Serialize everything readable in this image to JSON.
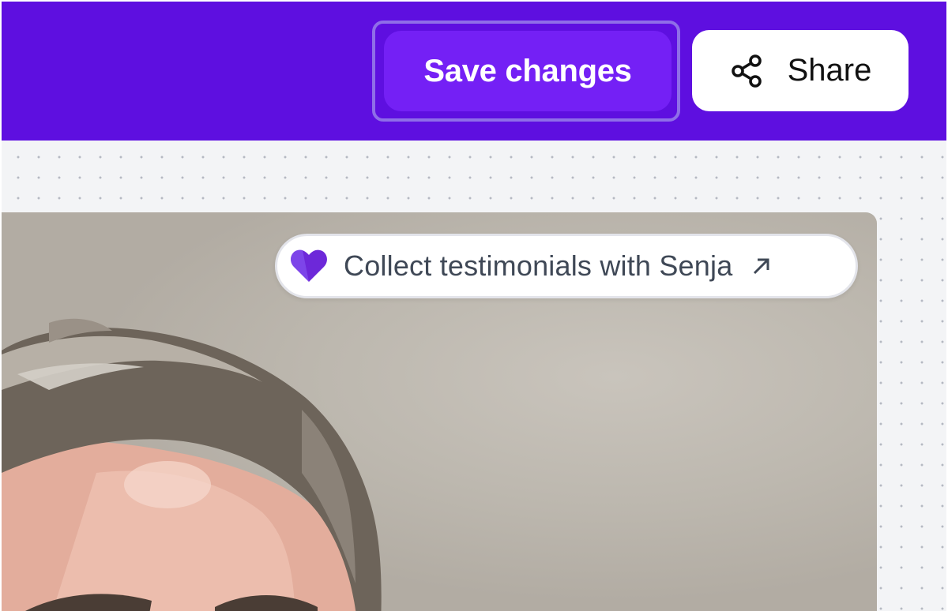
{
  "header": {
    "save_label": "Save changes",
    "share_label": "Share",
    "share_icon": "share-icon",
    "background_color": "#5e0fe0",
    "save_button_color": "#7420f5"
  },
  "canvas": {
    "background_color": "#f3f4f6",
    "cta": {
      "label": "Collect testimonials with Senja",
      "leading_icon": "heart-icon",
      "trailing_icon": "arrow-up-right-icon",
      "heart_color": "#6d28d9"
    }
  }
}
